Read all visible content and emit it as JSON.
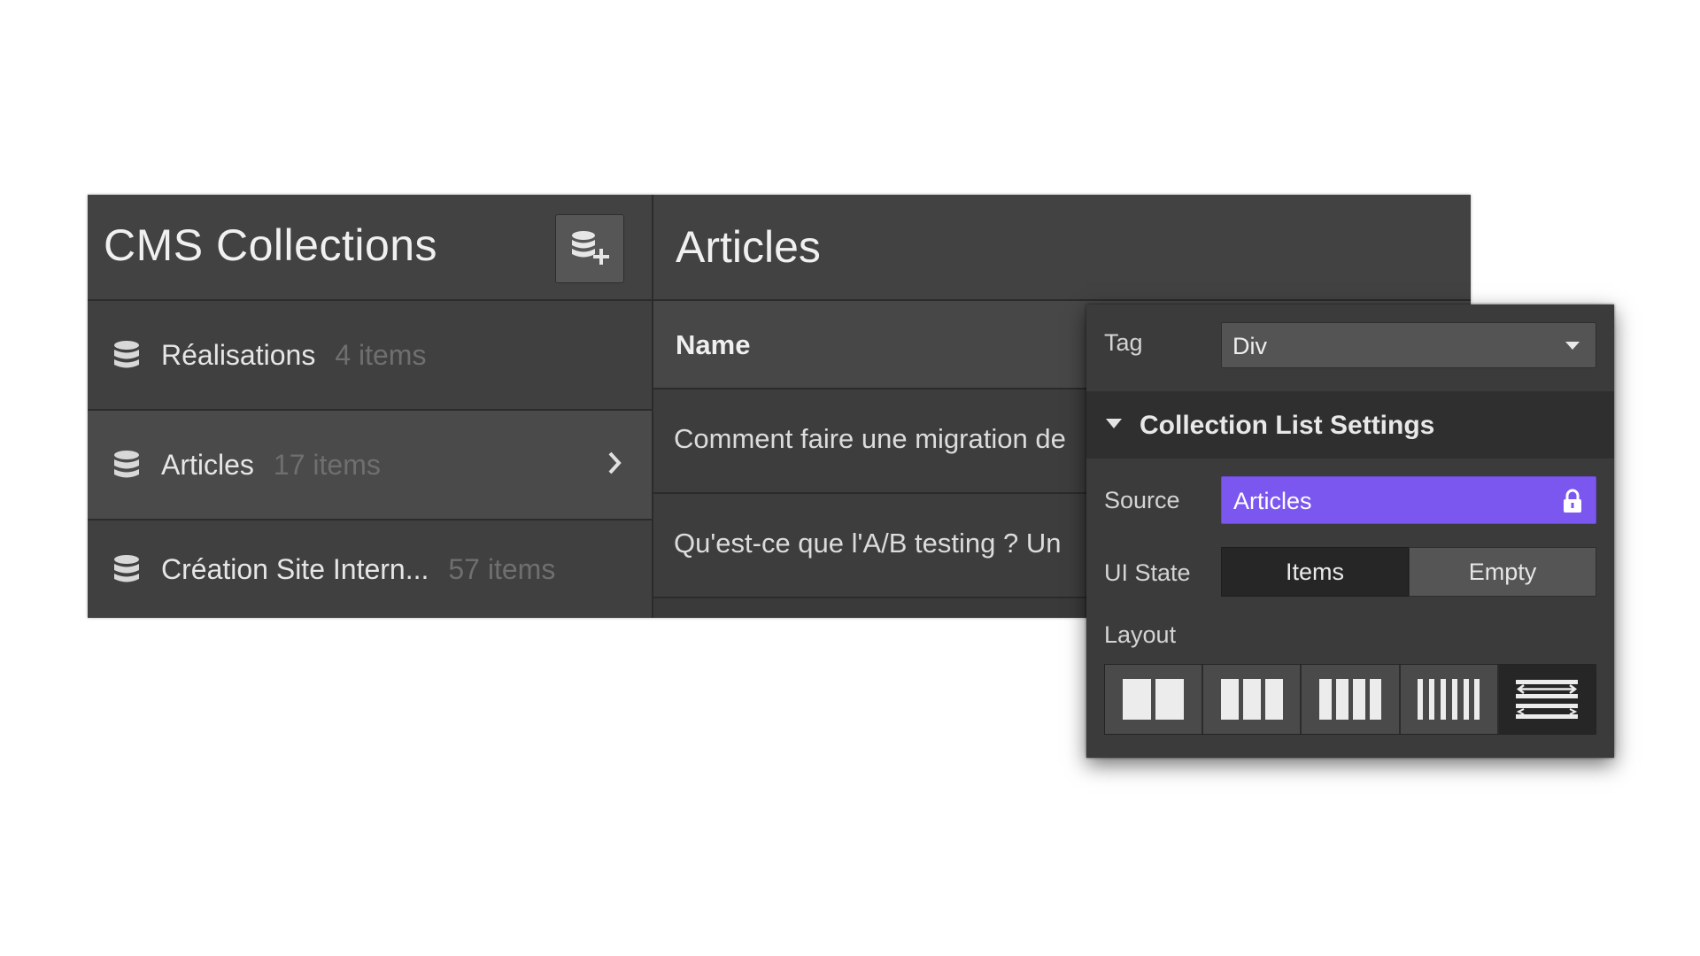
{
  "cms": {
    "title": "CMS Collections",
    "add_icon": "add-collection-icon",
    "collections": [
      {
        "name": "Réalisations",
        "count": "4 items"
      },
      {
        "name": "Articles",
        "count": "17 items"
      },
      {
        "name": "Création Site Intern...",
        "count": "57 items"
      }
    ]
  },
  "articles": {
    "title": "Articles",
    "column_name": "Name",
    "rows": [
      "Comment faire une migration de",
      "Qu'est-ce que l'A/B testing ? Un"
    ]
  },
  "settings": {
    "tag_label": "Tag",
    "tag_value": "Div",
    "section_title": "Collection List Settings",
    "source_label": "Source",
    "source_value": "Articles",
    "ui_state_label": "UI State",
    "ui_state_options": [
      "Items",
      "Empty"
    ],
    "ui_state_selected": "Items",
    "layout_label": "Layout",
    "layout_options": [
      "2-columns",
      "3-columns",
      "4-columns",
      "6-columns",
      "list"
    ],
    "layout_selected": "list"
  },
  "colors": {
    "accent": "#7b57f0",
    "panel": "#3b3b3b",
    "header": "#424242"
  }
}
